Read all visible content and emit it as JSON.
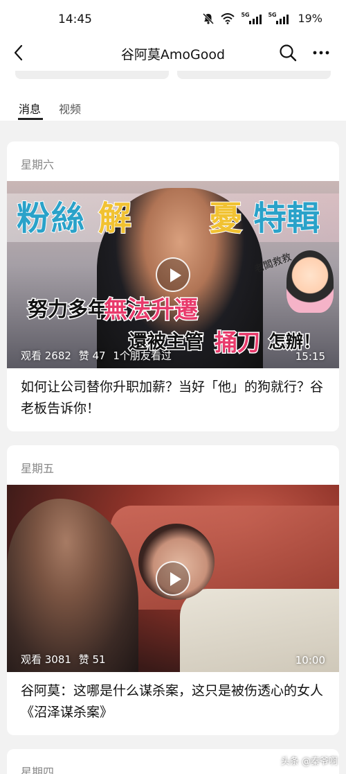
{
  "status_bar": {
    "time": "14:45",
    "net1": "5G",
    "net2": "5G",
    "battery": "19%"
  },
  "nav": {
    "title": "谷阿莫AmoGood"
  },
  "tabs": [
    {
      "label": "消息",
      "active": true
    },
    {
      "label": "视频",
      "active": false
    }
  ],
  "cards": [
    {
      "day": "星期六",
      "views": "观看 2682",
      "likes": "赞 47",
      "friends": "1个朋友看过",
      "duration": "15:15",
      "title": "如何让公司替你升职加薪？当好「他」的狗就行？谷老板告诉你！",
      "overlay": {
        "h1": "粉絲",
        "h2": "解",
        "h3": "憂",
        "h4": "特輯",
        "c1": "努力多年",
        "c2": "無法升遷",
        "d1": "還被主管",
        "d2": "捅刀",
        "d3": "怎辦！",
        "tag": "老闆救救"
      }
    },
    {
      "day": "星期五",
      "views": "观看 3081",
      "likes": "赞 51",
      "duration": "10:00",
      "title": "谷阿莫：这哪是什么谋杀案，这只是被伤透心的女人《沼泽谋杀案》"
    },
    {
      "day": "星期四"
    }
  ],
  "watermark": "头条 @秦爷啊",
  "colors": {
    "accent_blue": "#2aa2c9",
    "accent_yellow": "#f1c232",
    "accent_pink": "#e83a6b"
  }
}
